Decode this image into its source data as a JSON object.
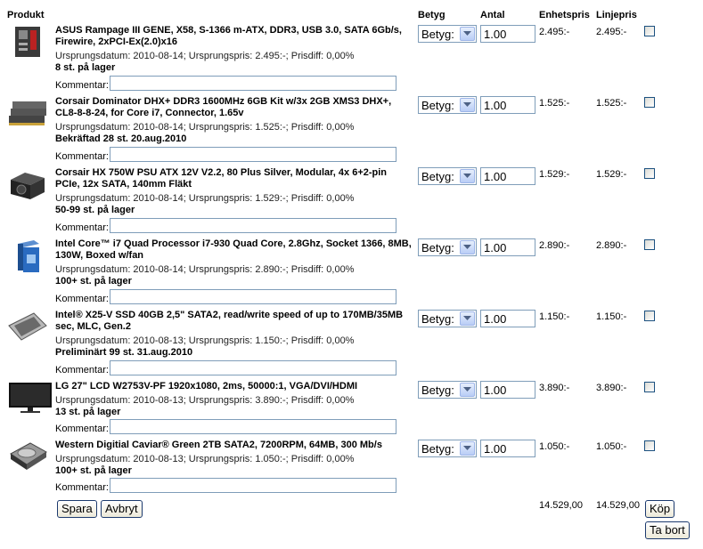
{
  "headers": {
    "product": "Produkt",
    "rating": "Betyg",
    "quantity": "Antal",
    "unit_price": "Enhetspris",
    "line_price": "Linjepris"
  },
  "comment_label": "Kommentar:",
  "items": [
    {
      "name": "ASUS Rampage III GENE, X58, S-1366 m-ATX, DDR3, USB 3.0, SATA 6Gb/s, Firewire, 2xPCI-Ex(2.0)x16",
      "meta": "Ursprungsdatum: 2010-08-14; Ursprungspris: 2.495:-; Prisdiff: 0,00%",
      "stock": "8 st. på lager",
      "rating": "Betyg:",
      "qty": "1.00",
      "unit": "2.495:-",
      "line": "2.495:-"
    },
    {
      "name": "Corsair Dominator DHX+ DDR3 1600MHz 6GB Kit w/3x 2GB XMS3 DHX+, CL8-8-8-24, for Core i7, Connector, 1.65v",
      "meta": "Ursprungsdatum: 2010-08-14; Ursprungspris: 1.525:-; Prisdiff: 0,00%",
      "stock": "Bekräftad 28 st. 20.aug.2010",
      "rating": "Betyg:",
      "qty": "1.00",
      "unit": "1.525:-",
      "line": "1.525:-"
    },
    {
      "name": "Corsair HX 750W PSU ATX 12V V2.2, 80 Plus Silver, Modular, 4x 6+2-pin PCIe, 12x SATA, 140mm Fläkt",
      "meta": "Ursprungsdatum: 2010-08-14; Ursprungspris: 1.529:-; Prisdiff: 0,00%",
      "stock": "50-99 st. på lager",
      "rating": "Betyg:",
      "qty": "1.00",
      "unit": "1.529:-",
      "line": "1.529:-"
    },
    {
      "name": "Intel Core™ i7 Quad Processor i7-930 Quad Core, 2.8Ghz, Socket 1366, 8MB, 130W, Boxed w/fan",
      "meta": "Ursprungsdatum: 2010-08-14; Ursprungspris: 2.890:-; Prisdiff: 0,00%",
      "stock": "100+ st. på lager",
      "rating": "Betyg:",
      "qty": "1.00",
      "unit": "2.890:-",
      "line": "2.890:-"
    },
    {
      "name": "Intel® X25-V SSD 40GB 2,5\" SATA2, read/write speed of up to 170MB/35MB sec, MLC, Gen.2",
      "meta": "Ursprungsdatum: 2010-08-13; Ursprungspris: 1.150:-; Prisdiff: 0,00%",
      "stock": "Preliminärt 99 st. 31.aug.2010",
      "rating": "Betyg:",
      "qty": "1.00",
      "unit": "1.150:-",
      "line": "1.150:-"
    },
    {
      "name": "LG 27\" LCD W2753V-PF 1920x1080, 2ms, 50000:1, VGA/DVI/HDMI",
      "meta": "Ursprungsdatum: 2010-08-13; Ursprungspris: 3.890:-; Prisdiff: 0,00%",
      "stock": "13 st. på lager",
      "rating": "Betyg:",
      "qty": "1.00",
      "unit": "3.890:-",
      "line": "3.890:-"
    },
    {
      "name": "Western Digitial Caviar® Green 2TB SATA2, 7200RPM, 64MB, 300 Mb/s",
      "meta": "Ursprungsdatum: 2010-08-13; Ursprungspris: 1.050:-; Prisdiff: 0,00%",
      "stock": "100+ st. på lager",
      "rating": "Betyg:",
      "qty": "1.00",
      "unit": "1.050:-",
      "line": "1.050:-"
    }
  ],
  "totals": {
    "unit": "14.529,00",
    "line": "14.529,00"
  },
  "buttons": {
    "save": "Spara",
    "cancel": "Avbryt",
    "buy": "Köp",
    "remove": "Ta bort"
  }
}
